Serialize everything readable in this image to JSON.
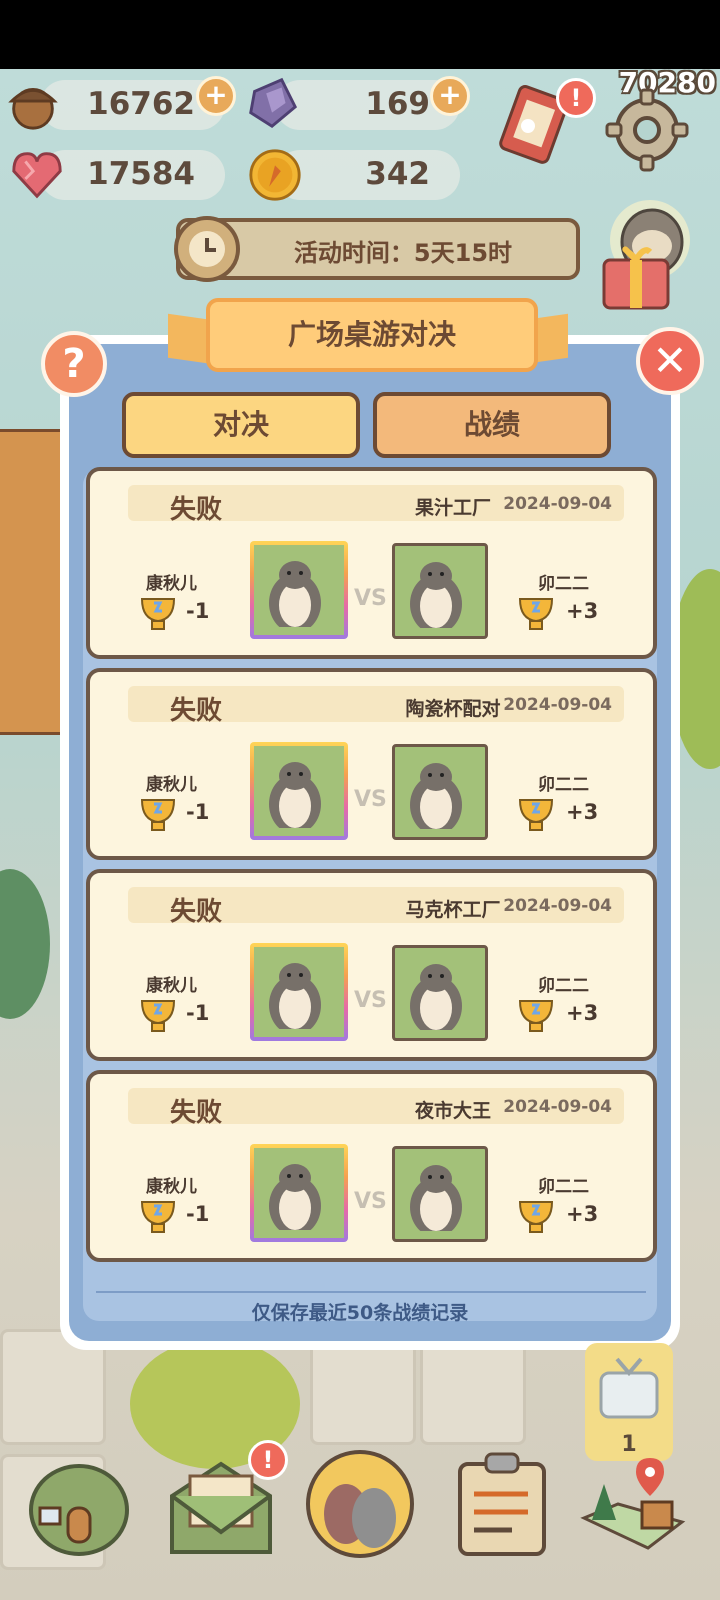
{
  "resources": {
    "acorn": {
      "value": "16762",
      "icon": "acorn-icon"
    },
    "gem": {
      "value": "169",
      "icon": "crystal-icon"
    },
    "heart": {
      "value": "17584",
      "icon": "heart-gem-icon"
    },
    "coin": {
      "value": "342",
      "icon": "carrot-coin-icon"
    }
  },
  "score": "70280",
  "event_timer": "活动时间：5天15时",
  "modal": {
    "title": "广场桌游对决",
    "help_label": "?",
    "close_label": "✕",
    "tabs": [
      {
        "label": "对决",
        "active": true
      },
      {
        "label": "战绩",
        "active": false
      }
    ],
    "footer_note": "仅保存最近50条战绩记录"
  },
  "vs_label": "VS",
  "records": [
    {
      "result": "失败",
      "game": "果汁工厂",
      "date": "2024-09-04",
      "player": {
        "name": "康秋儿",
        "delta": "-1"
      },
      "opponent": {
        "name": "卯二二",
        "delta": "+3"
      }
    },
    {
      "result": "失败",
      "game": "陶瓷杯配对",
      "date": "2024-09-04",
      "player": {
        "name": "康秋儿",
        "delta": "-1"
      },
      "opponent": {
        "name": "卯二二",
        "delta": "+3"
      }
    },
    {
      "result": "失败",
      "game": "马克杯工厂",
      "date": "2024-09-04",
      "player": {
        "name": "康秋儿",
        "delta": "-1"
      },
      "opponent": {
        "name": "卯二二",
        "delta": "+3"
      }
    },
    {
      "result": "失败",
      "game": "夜市大王",
      "date": "2024-09-04",
      "player": {
        "name": "康秋儿",
        "delta": "-1"
      },
      "opponent": {
        "name": "卯二二",
        "delta": "+3"
      }
    }
  ],
  "bottom_nav": {
    "gift_count": "1",
    "items": [
      {
        "icon": "house-icon"
      },
      {
        "icon": "mail-icon"
      },
      {
        "icon": "friends-icon"
      },
      {
        "icon": "clipboard-icon"
      },
      {
        "icon": "map-icon"
      }
    ]
  },
  "badges": {
    "alert": "!"
  },
  "colors": {
    "accent": "#f3b75d",
    "modal_blue": "#8eaed4",
    "close_red": "#ef6a5b",
    "text_brown": "#6d4a33"
  }
}
